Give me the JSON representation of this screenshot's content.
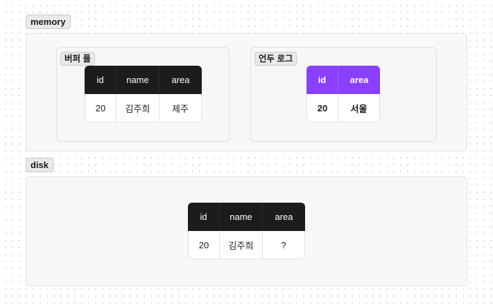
{
  "memory": {
    "label": "memory",
    "buffer_pool": {
      "label": "버퍼 풀",
      "columns": [
        "id",
        "name",
        "area"
      ],
      "row": [
        "20",
        "김주희",
        "제주"
      ]
    },
    "undo_log": {
      "label": "언두 로그",
      "columns": [
        "id",
        "area"
      ],
      "row": [
        "20",
        "서울"
      ]
    }
  },
  "disk": {
    "label": "disk",
    "table": {
      "columns": [
        "id",
        "name",
        "area"
      ],
      "row": [
        "20",
        "김주희",
        "?"
      ]
    }
  },
  "colors": {
    "table_header": "#1c1c1c",
    "undo_header": "#8a3ffc",
    "panel_bg": "#f8f8f8",
    "tag_bg": "#e9e9e9"
  }
}
